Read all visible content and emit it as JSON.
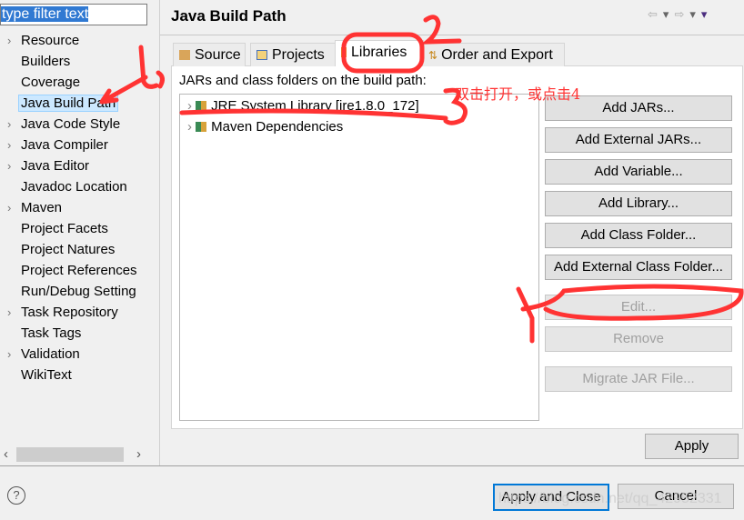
{
  "filter": {
    "value": "type filter text"
  },
  "sidebar": {
    "items": [
      {
        "label": "Resource",
        "expandable": true
      },
      {
        "label": "Builders",
        "expandable": false
      },
      {
        "label": "Coverage",
        "expandable": false
      },
      {
        "label": "Java Build Path",
        "expandable": false,
        "selected": true
      },
      {
        "label": "Java Code Style",
        "expandable": true
      },
      {
        "label": "Java Compiler",
        "expandable": true
      },
      {
        "label": "Java Editor",
        "expandable": true
      },
      {
        "label": "Javadoc Location",
        "expandable": false
      },
      {
        "label": "Maven",
        "expandable": true
      },
      {
        "label": "Project Facets",
        "expandable": false
      },
      {
        "label": "Project Natures",
        "expandable": false
      },
      {
        "label": "Project References",
        "expandable": false
      },
      {
        "label": "Run/Debug Setting",
        "expandable": false
      },
      {
        "label": "Task Repository",
        "expandable": true
      },
      {
        "label": "Task Tags",
        "expandable": false
      },
      {
        "label": "Validation",
        "expandable": true
      },
      {
        "label": "WikiText",
        "expandable": false
      }
    ]
  },
  "header": {
    "title": "Java Build Path"
  },
  "tabs": [
    {
      "label": "Source",
      "icon": "source-icon"
    },
    {
      "label": "Projects",
      "icon": "folder-icon"
    },
    {
      "label": "Libraries",
      "icon": "library-icon",
      "active": true
    },
    {
      "label": "Order and Export",
      "icon": "order-icon"
    }
  ],
  "libraries": {
    "caption": "JARs and class folders on the build path:",
    "items": [
      "JRE System Library [jre1.8.0_172]",
      "Maven Dependencies"
    ]
  },
  "buttons": {
    "add_jars": "Add JARs...",
    "add_external_jars": "Add External JARs...",
    "add_variable": "Add Variable...",
    "add_library": "Add Library...",
    "add_class_folder": "Add Class Folder...",
    "add_external_class_folder": "Add External Class Folder...",
    "edit": "Edit...",
    "remove": "Remove",
    "migrate": "Migrate JAR File...",
    "apply": "Apply",
    "apply_close": "Apply and Close",
    "cancel": "Cancel"
  },
  "annotation": {
    "text": "双击打开，或点击4",
    "color": "#ff3333",
    "marks": [
      "1",
      "2",
      "3",
      "4"
    ]
  },
  "watermark": "https://blog.csdn.net/qq_42952331"
}
